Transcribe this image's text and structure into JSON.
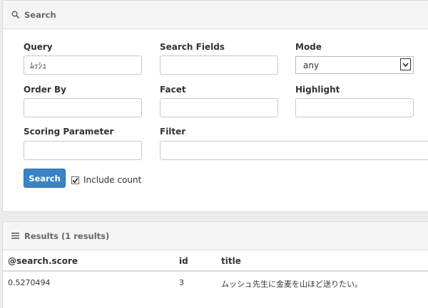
{
  "search_panel": {
    "title": "Search",
    "fields": {
      "query": {
        "label": "Query",
        "value": "ﾑｯｼｭ"
      },
      "search_fields": {
        "label": "Search Fields",
        "value": ""
      },
      "mode": {
        "label": "Mode",
        "selected": "any"
      },
      "order_by": {
        "label": "Order By",
        "value": ""
      },
      "facet": {
        "label": "Facet",
        "value": ""
      },
      "highlight": {
        "label": "Highlight",
        "value": ""
      },
      "scoring_parameter": {
        "label": "Scoring Parameter",
        "value": ""
      },
      "filter": {
        "label": "Filter",
        "value": ""
      }
    },
    "search_button": "Search",
    "include_count": {
      "label": "Include count",
      "checked": true
    }
  },
  "results_panel": {
    "title": "Results (1 results)",
    "columns": [
      "@search.score",
      "id",
      "title"
    ],
    "rows": [
      [
        "0.5270494",
        "3",
        "ムッシュ先生に金麦を山ほど送りたい。"
      ]
    ]
  },
  "colors": {
    "primary_button": "#3a84c6",
    "panel_header": "#f5f5f5",
    "background": "#ececec"
  },
  "icons": {
    "search_header": "search-icon",
    "results_header": "list-icon",
    "mode_dropdown": "chevron-down-icon",
    "checkbox": "check-icon"
  }
}
